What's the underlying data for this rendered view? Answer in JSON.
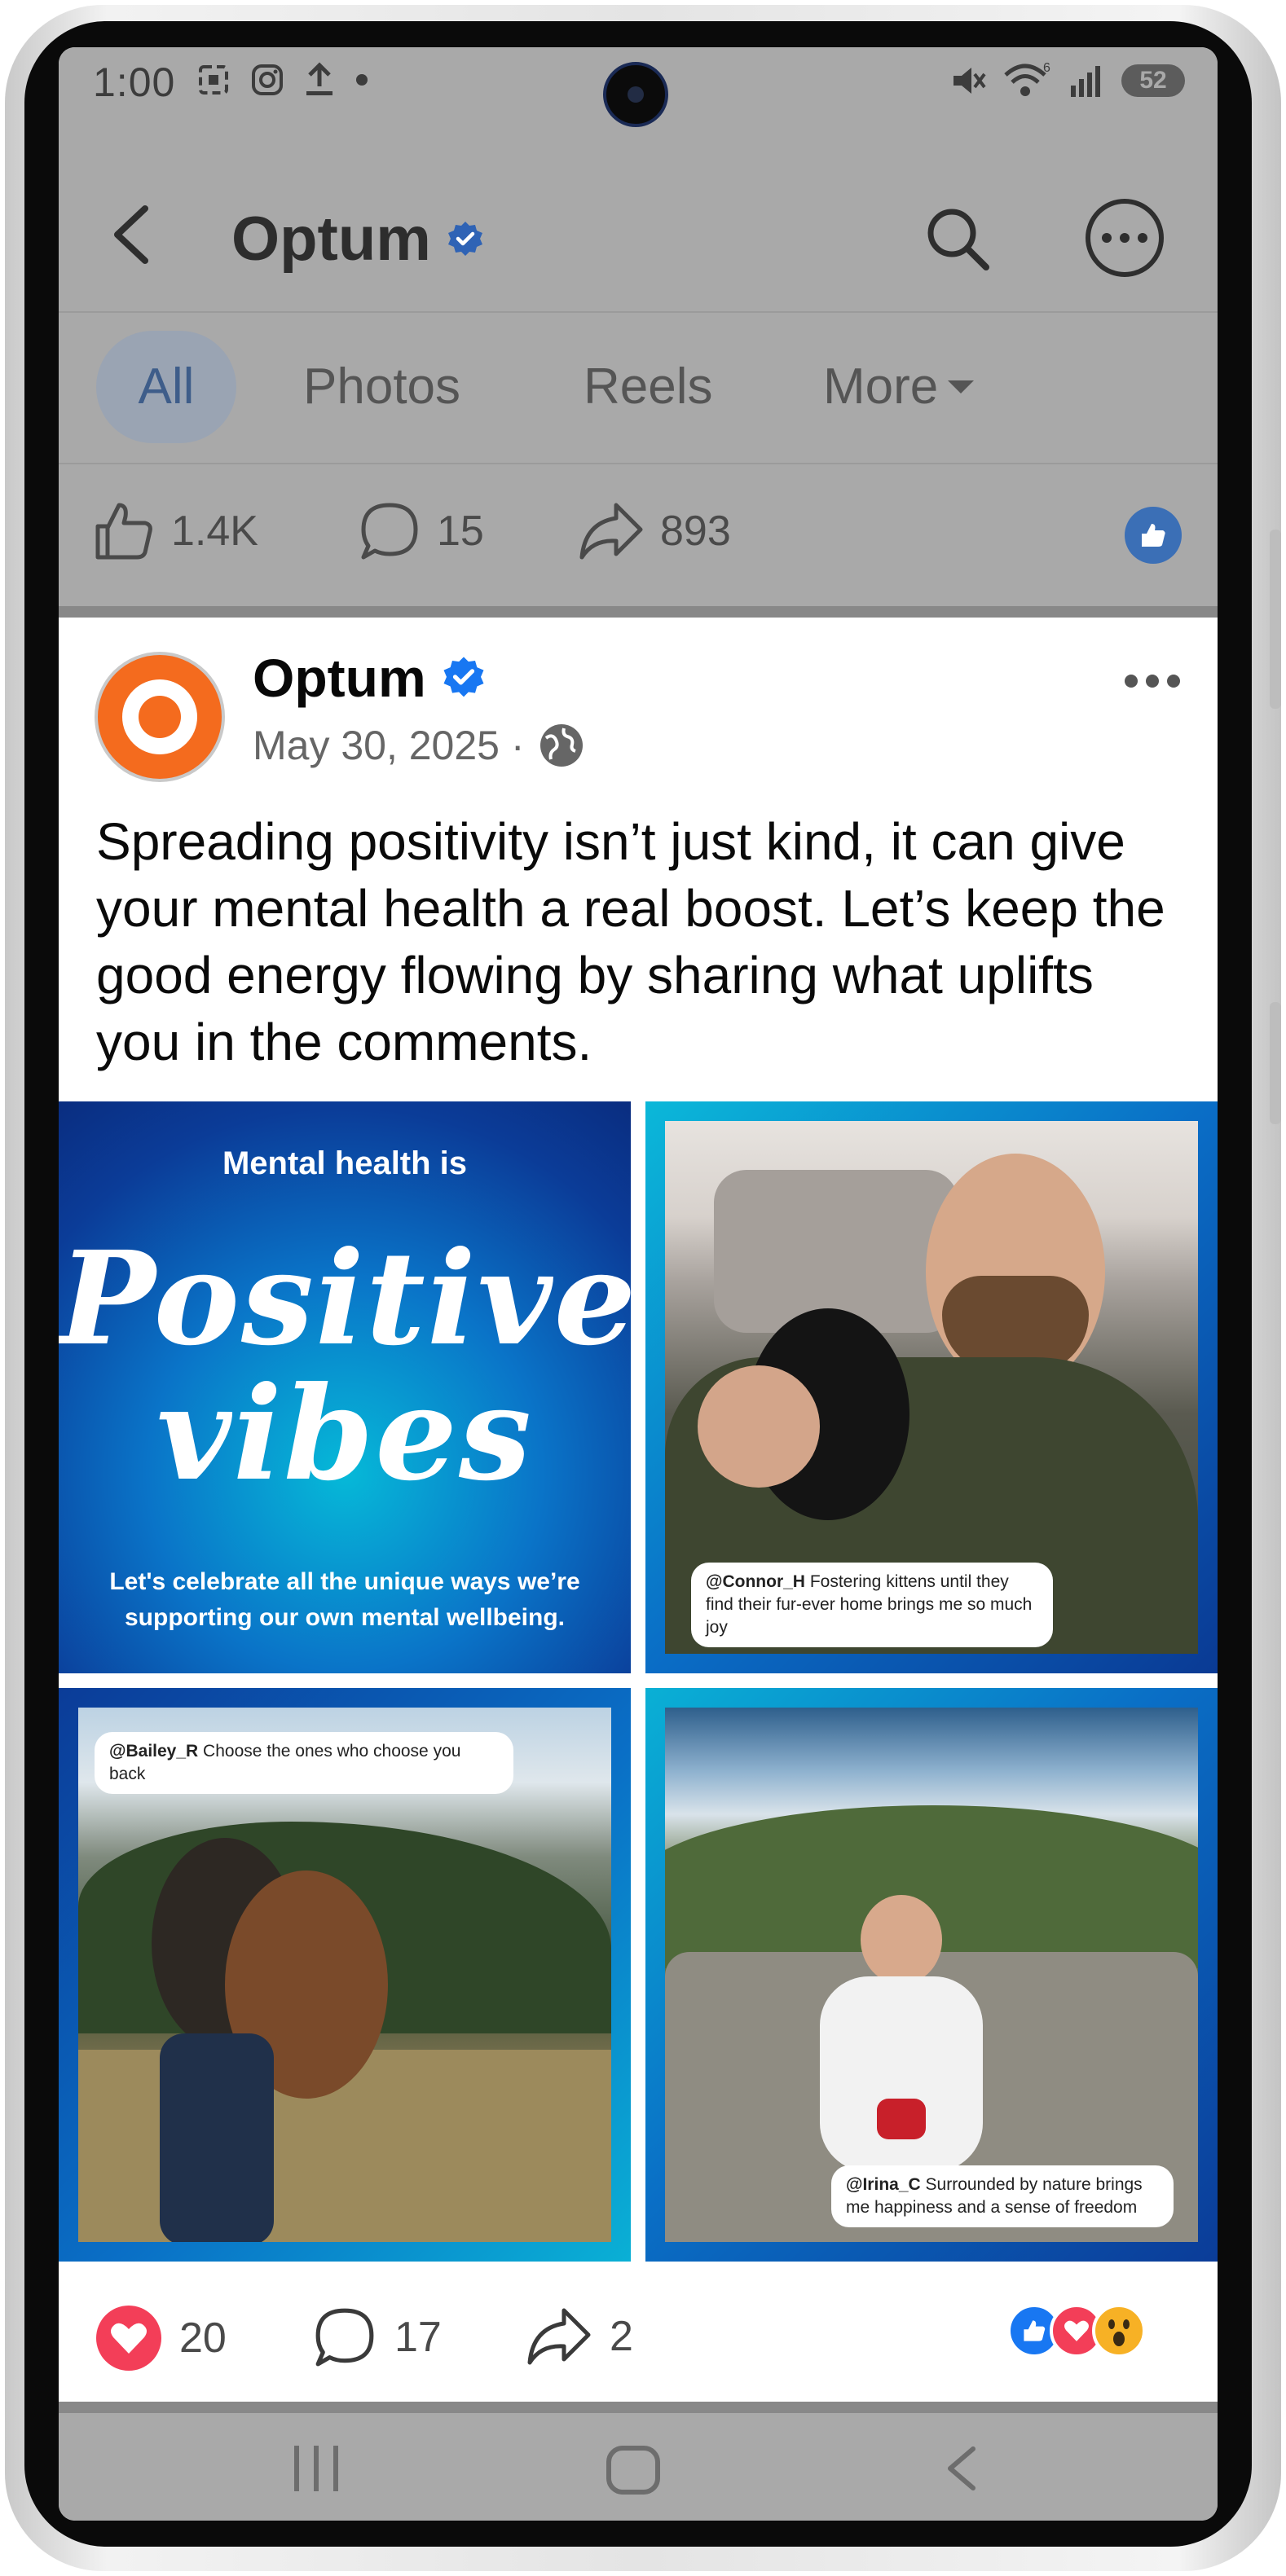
{
  "status_bar": {
    "time": "1:00",
    "left_icons": [
      "screenshot-icon",
      "instagram-icon",
      "upload-icon",
      "dot-icon"
    ],
    "right_icons": [
      "mute-icon",
      "wifi-icon",
      "signal-icon"
    ],
    "wifi_badge": "6",
    "battery": "52"
  },
  "topbar": {
    "title": "Optum",
    "verified": true
  },
  "tabs": [
    {
      "label": "All",
      "active": true
    },
    {
      "label": "Photos",
      "active": false
    },
    {
      "label": "Reels",
      "active": false
    },
    {
      "label": "More",
      "active": false
    }
  ],
  "prev_post_stats": {
    "likes": "1.4K",
    "comments": "15",
    "shares": "893"
  },
  "post": {
    "author": "Optum",
    "date": "May 30, 2025 ·",
    "text": "Spreading positivity isn’t just kind, it can give your mental health a real boost. Let’s keep the good energy flowing by sharing what uplifts you in the comments.",
    "images": {
      "tile1": {
        "heading": "Mental health is",
        "big_line1": "Positive",
        "big_line2": "vibes",
        "footer": "Let's celebrate all the unique ways we’re supporting our own mental wellbeing."
      },
      "tile2": {
        "handle": "@Connor_H",
        "caption": "Fostering kittens until they find their fur-ever home brings me so much joy"
      },
      "tile3": {
        "handle": "@Bailey_R",
        "caption": "Choose the ones who choose you back"
      },
      "tile4": {
        "handle": "@Irina_C",
        "caption": "Surrounded by nature brings me happiness and a sense of freedom"
      }
    },
    "reactions": {
      "loves": "20",
      "comments": "17",
      "shares": "2",
      "stack": [
        "like-icon",
        "love-icon",
        "wow-icon"
      ]
    }
  },
  "colors": {
    "accent_blue": "#1877f2",
    "love_red": "#f33e58",
    "optum_orange": "#f46b1e",
    "dim_overlay": "#a9a9a9"
  }
}
